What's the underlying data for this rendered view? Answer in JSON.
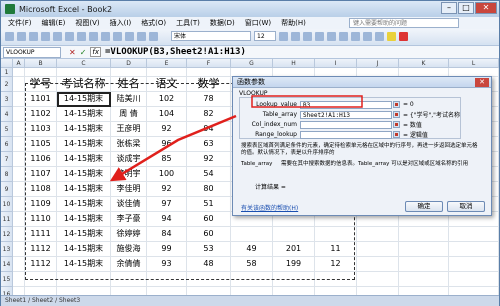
{
  "window": {
    "title": "Microsoft Excel - Book2",
    "minimize": "–",
    "maximize": "□",
    "close": "✕"
  },
  "menu": [
    "文件(F)",
    "编辑(E)",
    "视图(V)",
    "插入(I)",
    "格式(O)",
    "工具(T)",
    "数据(D)",
    "窗口(W)",
    "帮助(H)"
  ],
  "help_placeholder": "键入需要帮助的问题",
  "toolbar": {
    "font": "宋体",
    "size": "12"
  },
  "formula_bar": {
    "name_box": "VLOOKUP",
    "cancel": "✕",
    "enter": "✓",
    "fx": "fx",
    "formula": "=VLOOKUP(B3,Sheet2!A1:H13)"
  },
  "columns": [
    "A",
    "B",
    "C",
    "D",
    "E",
    "F",
    "G",
    "H",
    "I",
    "J",
    "K",
    "L"
  ],
  "headers": [
    "学号",
    "考试名称",
    "姓名",
    "语文",
    "数学"
  ],
  "rows": [
    {
      "n": "1",
      "id": "",
      "exam": "",
      "name": "",
      "c": "",
      "m": ""
    },
    {
      "n": "2",
      "id": "学号",
      "exam": "考试名称",
      "name": "姓名",
      "c": "语文",
      "m": "数学"
    },
    {
      "n": "3",
      "id": "1101",
      "exam": "14-15期末",
      "name": "陆美川",
      "c": "102",
      "m": "78"
    },
    {
      "n": "4",
      "id": "1102",
      "exam": "14-15期末",
      "name": "周  倩",
      "c": "104",
      "m": "82"
    },
    {
      "n": "5",
      "id": "1103",
      "exam": "14-15期末",
      "name": "王彦明",
      "c": "92",
      "m": "94"
    },
    {
      "n": "6",
      "id": "1105",
      "exam": "14-15期末",
      "name": "张栋梁",
      "c": "96",
      "m": "63"
    },
    {
      "n": "7",
      "id": "1106",
      "exam": "14-15期末",
      "name": "谈成宇",
      "c": "85",
      "m": "92"
    },
    {
      "n": "8",
      "id": "1107",
      "exam": "14-15期末",
      "name": "管明宇",
      "c": "100",
      "m": "54"
    },
    {
      "n": "9",
      "id": "1108",
      "exam": "14-15期末",
      "name": "李佳明",
      "c": "92",
      "m": "80"
    },
    {
      "n": "10",
      "id": "1109",
      "exam": "14-15期末",
      "name": "谈佳倩",
      "c": "97",
      "m": "51"
    },
    {
      "n": "11",
      "id": "1110",
      "exam": "14-15期末",
      "name": "李子豪",
      "c": "94",
      "m": "60"
    },
    {
      "n": "12",
      "id": "1111",
      "exam": "14-15期末",
      "name": "徐婷婷",
      "c": "84",
      "m": "60"
    },
    {
      "n": "13",
      "id": "1112",
      "exam": "14-15期末",
      "name": "施俊海",
      "c": "99",
      "m": "53"
    },
    {
      "n": "14",
      "id": "1112",
      "exam": "14-15期末",
      "name": "余倩倩",
      "c": "93",
      "m": "48"
    },
    {
      "n": "15",
      "id": "",
      "exam": "",
      "name": "",
      "c": "",
      "m": ""
    },
    {
      "n": "16",
      "id": "",
      "exam": "",
      "name": "",
      "c": "",
      "m": ""
    },
    {
      "n": "17",
      "id": "",
      "exam": "",
      "name": "",
      "c": "",
      "m": ""
    }
  ],
  "extra": {
    "row13": {
      "f": "49",
      "g": "201",
      "h": "11"
    },
    "row14": {
      "f": "58",
      "g": "199",
      "h": "12"
    }
  },
  "sheet_tabs": "Sheet1 / Sheet2 / Sheet3",
  "dialog": {
    "title": "函数参数",
    "close": "✕",
    "fn": "VLOOKUP",
    "args": [
      {
        "label": "Lookup_value",
        "value": "B3",
        "result": "= 0"
      },
      {
        "label": "Table_array",
        "value": "Sheet2!A1:H13",
        "result": "= {\"学号\",\"考试名称"
      },
      {
        "label": "Col_index_num",
        "value": "",
        "result": "= 数值"
      },
      {
        "label": "Range_lookup",
        "value": "",
        "result": "= 逻辑值"
      }
    ],
    "desc1": "搜索表区域首列满足条件的元素，确定待检索单元格在区域中的行序号，再进一步返回选定单元格的值。默认情况下，表是以升序排序的",
    "desc2_label": "Table_array",
    "desc2": "需要在其中搜索数据的信息表。Table_array 可以是对区域或区域名称的引用",
    "calc": "计算结果 =",
    "help_link": "有关该函数的帮助(H)",
    "ok": "确定",
    "cancel": "取消"
  }
}
